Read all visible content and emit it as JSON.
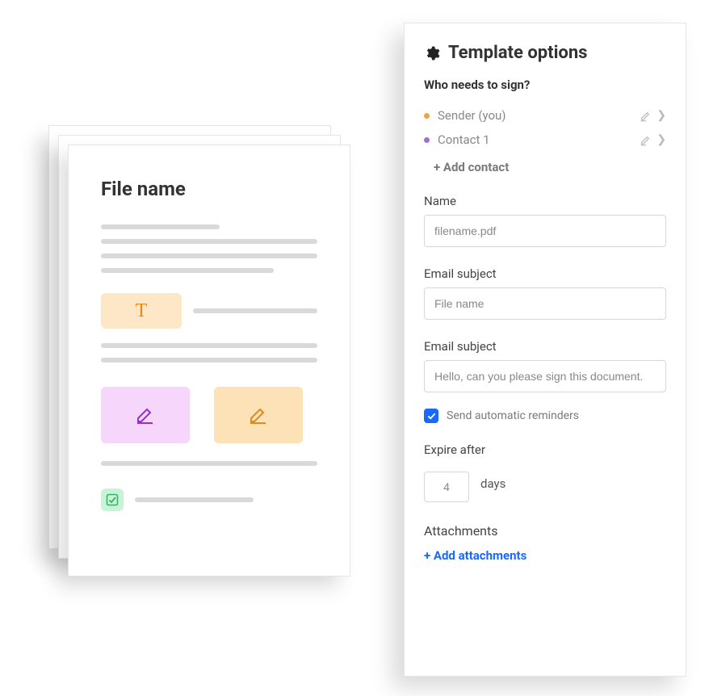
{
  "doc": {
    "title": "File name"
  },
  "panel": {
    "title": "Template options",
    "who": "Who needs to sign?",
    "signers": [
      {
        "label": "Sender (you)"
      },
      {
        "label": "Contact 1"
      }
    ],
    "add_contact": "+ Add contact",
    "name_label": "Name",
    "name_value": "filename.pdf",
    "subject1_label": "Email subject",
    "subject1_value": "File name",
    "subject2_label": "Email subject",
    "subject2_value": "Hello, can you please sign this document.",
    "reminder_label": "Send automatic reminders",
    "expire_label": "Expire after",
    "expire_value": "4",
    "expire_unit": "days",
    "attachments_label": "Attachments",
    "add_attachments": "+ Add attachments"
  }
}
